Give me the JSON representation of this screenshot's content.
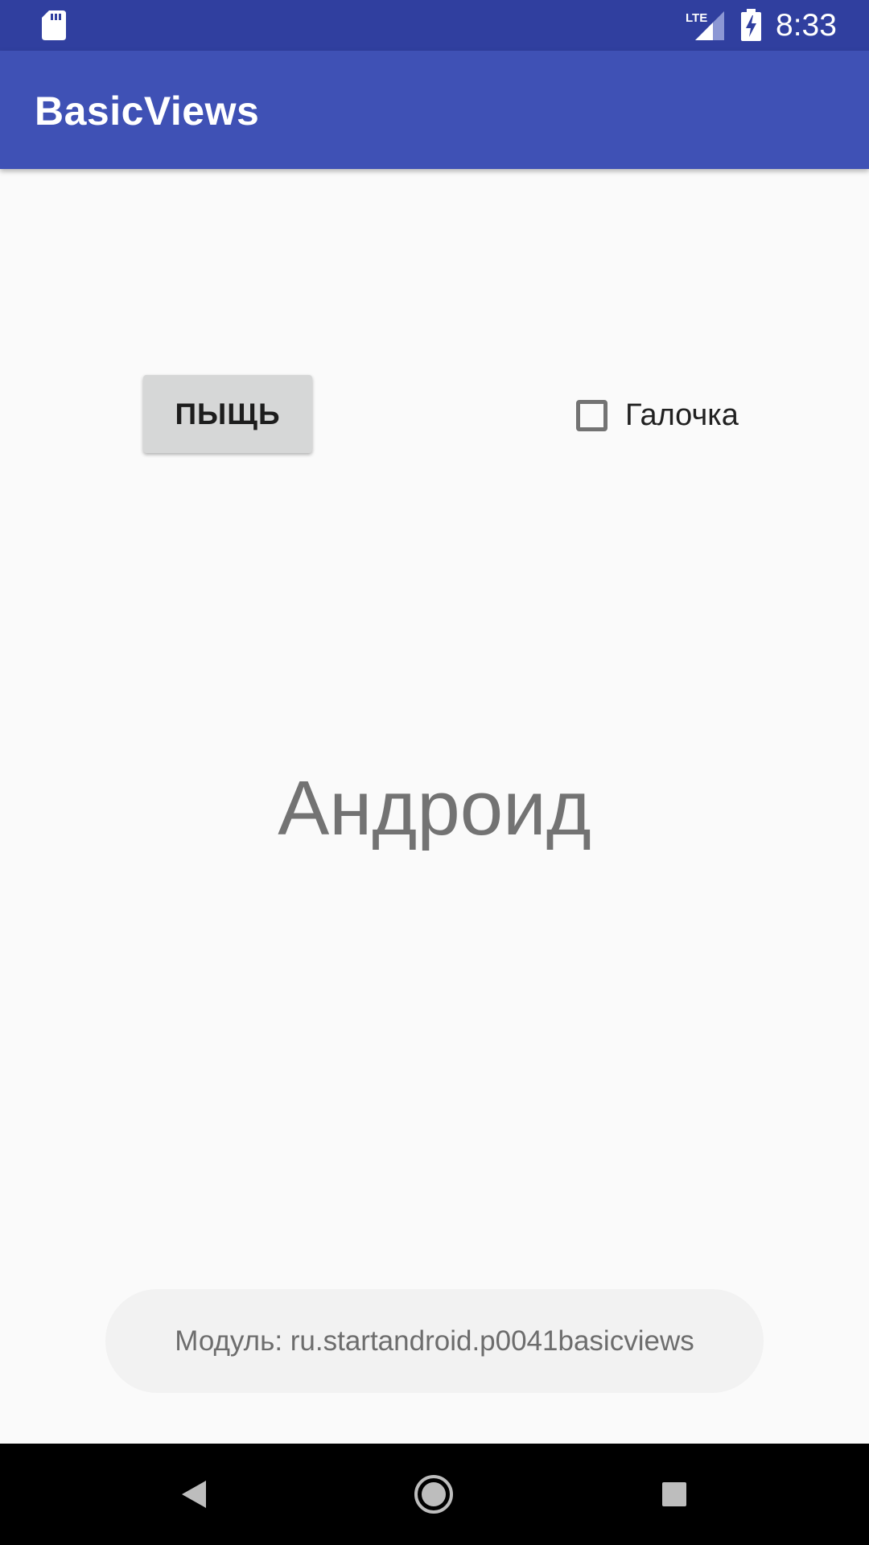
{
  "status_bar": {
    "time": "8:33",
    "icons": [
      "sd-card-icon",
      "lte-signal-icon",
      "battery-charging-icon"
    ],
    "color": "#303f9f"
  },
  "app_bar": {
    "title": "BasicViews",
    "color": "#3f51b5"
  },
  "main": {
    "button_label": "ПЫЩЬ",
    "checkbox": {
      "label": "Галочка",
      "checked": false
    },
    "text_view": "Андроид"
  },
  "toast": {
    "message": "Модуль: ru.startandroid.p0041basicviews"
  },
  "nav_bar": {
    "icons": [
      "back-icon",
      "home-icon",
      "recents-icon"
    ]
  }
}
